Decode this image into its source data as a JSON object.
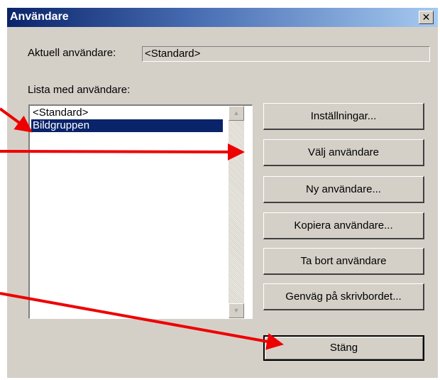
{
  "window": {
    "title": "Användare",
    "close_glyph": "✕"
  },
  "current_user": {
    "label": "Aktuell användare:",
    "value": "<Standard>"
  },
  "user_list": {
    "label": "Lista med användare:",
    "items": [
      {
        "label": "<Standard>",
        "selected": false
      },
      {
        "label": "Bildgruppen",
        "selected": true
      }
    ],
    "scroll_up_icon": "triangle-up",
    "scroll_down_icon": "triangle-down"
  },
  "buttons": {
    "settings": "Inställningar...",
    "select_user": "Välj användare",
    "new_user": "Ny användare...",
    "copy_user": "Kopiera användare...",
    "delete_user": "Ta bort användare",
    "desktop_shortcut": "Genväg på skrivbordet...",
    "close": "Stäng"
  },
  "colors": {
    "annotation_arrow": "#ee0000",
    "selection": "#0a246a",
    "dialog_face": "#d4d0c8"
  }
}
